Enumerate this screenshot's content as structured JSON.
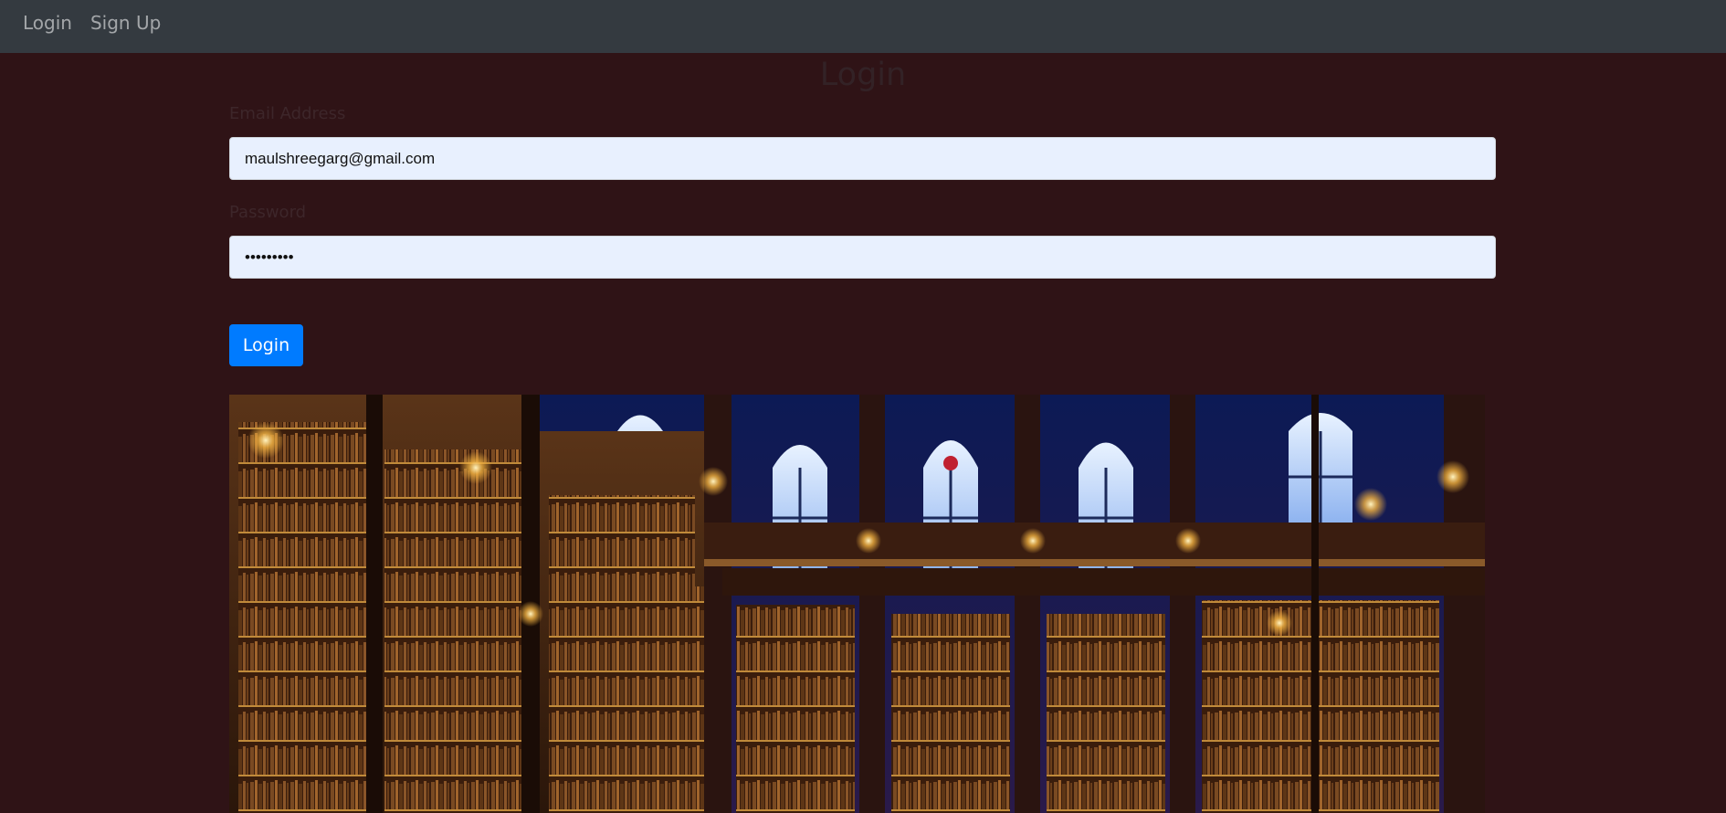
{
  "nav": {
    "login_label": "Login",
    "signup_label": "Sign Up"
  },
  "page": {
    "title": "Login"
  },
  "form": {
    "email_label": "Email Address",
    "email_value": "maulshreegarg@gmail.com",
    "password_label": "Password",
    "password_value": "•••••••••",
    "submit_label": "Login"
  },
  "colors": {
    "navbar_bg": "#343a40",
    "page_bg": "#2f1316",
    "input_bg": "#e8f0fe",
    "primary_button": "#007bff"
  },
  "image": {
    "subject": "gothic-library-interior"
  }
}
